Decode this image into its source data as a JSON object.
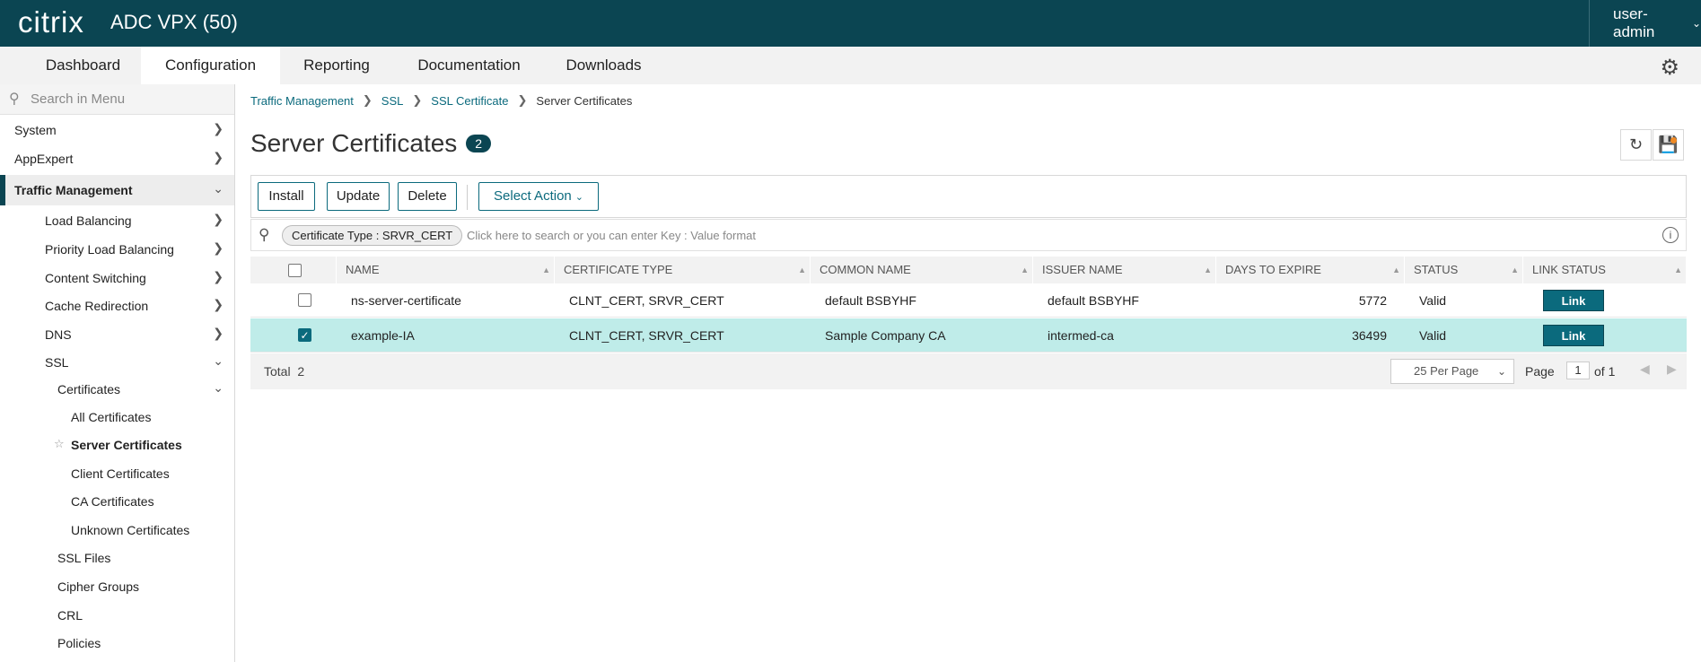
{
  "header": {
    "logo": "citrix",
    "product": "ADC VPX (50)",
    "user": "user-admin"
  },
  "nav": {
    "tabs": [
      "Dashboard",
      "Configuration",
      "Reporting",
      "Documentation",
      "Downloads"
    ],
    "active": "Configuration"
  },
  "sidebar": {
    "search_placeholder": "Search in Menu",
    "items": [
      "System",
      "AppExpert",
      "Traffic Management",
      "Load Balancing",
      "Priority Load Balancing",
      "Content Switching",
      "Cache Redirection",
      "DNS",
      "SSL",
      "Certificates",
      "All Certificates",
      "Server Certificates",
      "Client Certificates",
      "CA Certificates",
      "Unknown Certificates",
      "SSL Files",
      "Cipher Groups",
      "CRL",
      "Policies"
    ]
  },
  "breadcrumb": [
    "Traffic Management",
    "SSL",
    "SSL Certificate",
    "Server Certificates"
  ],
  "page": {
    "title": "Server Certificates",
    "count": "2"
  },
  "toolbar": {
    "install": "Install",
    "update": "Update",
    "delete": "Delete",
    "select_action": "Select Action"
  },
  "filter": {
    "chip": "Certificate Type : SRVR_CERT",
    "placeholder": "Click here to search or you can enter Key : Value format"
  },
  "table": {
    "columns": [
      "NAME",
      "CERTIFICATE TYPE",
      "COMMON NAME",
      "ISSUER NAME",
      "DAYS TO EXPIRE",
      "STATUS",
      "LINK STATUS"
    ],
    "rows": [
      {
        "name": "ns-server-certificate",
        "type": "CLNT_CERT, SRVR_CERT",
        "common": "default BSBYHF",
        "issuer": "default BSBYHF",
        "days": "5772",
        "status": "Valid",
        "link": "Link",
        "checked": false
      },
      {
        "name": "example-IA",
        "type": "CLNT_CERT, SRVR_CERT",
        "common": "Sample Company CA",
        "issuer": "intermed-ca",
        "days": "36499",
        "status": "Valid",
        "link": "Link",
        "checked": true
      }
    ]
  },
  "footer": {
    "total_label": "Total",
    "total": "2",
    "per_page": "25 Per Page",
    "page_label": "Page",
    "page": "1",
    "of": "of 1"
  },
  "colors": {
    "brand": "#0b4552",
    "accent": "#0b6a7d",
    "selected_row": "#bfece9"
  }
}
